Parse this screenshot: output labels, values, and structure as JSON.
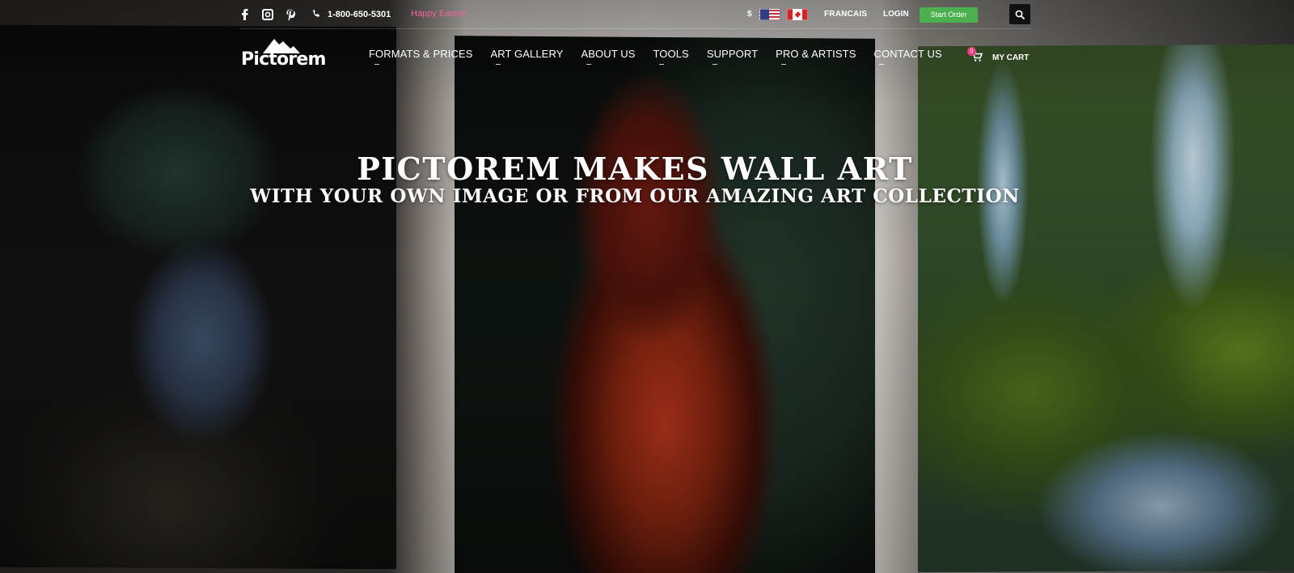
{
  "topbar": {
    "phone": "1-800-650-5301",
    "promo": "Happy Easter!",
    "currency": "$",
    "language": "FRANCAIS",
    "login": "LOGIN",
    "start_order": "Start Order",
    "social_icons": [
      "facebook-icon",
      "instagram-icon",
      "pinterest-icon"
    ],
    "promo_color": "#f0679b",
    "start_order_color": "#4caf50"
  },
  "logo": {
    "text": "Pictorem"
  },
  "nav": {
    "items": [
      "FORMATS & PRICES",
      "ART GALLERY",
      "ABOUT US",
      "TOOLS",
      "SUPPORT",
      "PRO & ARTISTS",
      "CONTACT US"
    ]
  },
  "cart": {
    "count": "0",
    "label": "MY CART",
    "badge_color": "#e8417f"
  },
  "hero": {
    "headline": "PICTOREM MAKES WALL ART",
    "subline": "WITH YOUR OWN IMAGE OR FROM OUR AMAZING ART COLLECTION"
  }
}
